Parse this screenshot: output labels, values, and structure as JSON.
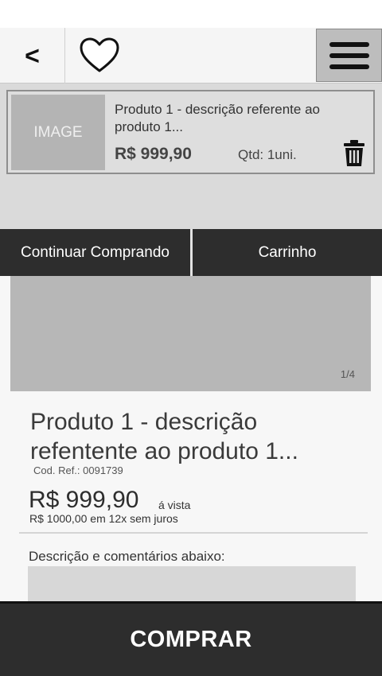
{
  "header": {
    "back_label": "<",
    "favorite_icon": "heart-icon",
    "menu_icon": "hamburger-menu-icon"
  },
  "cart": {
    "item": {
      "image_placeholder": "IMAGE",
      "title": "Produto 1 - descrição referente ao produto 1...",
      "price": "R$ 999,90",
      "quantity": "Qtd: 1uni.",
      "remove_icon": "trash-icon"
    }
  },
  "actions": {
    "continue_label": "Continuar Comprando",
    "cart_label": "Carrinho"
  },
  "carousel": {
    "indicator": "1/4",
    "current": 1,
    "total": 4
  },
  "product": {
    "title": "Produto 1 - descrição refentente ao produto 1...",
    "ref": "Cod. Ref.: 0091739",
    "price": "R$ 999,90",
    "price_note": "á vista",
    "installments": "R$ 1000,00 em 12x sem juros",
    "description_label": "Descrição e comentários abaixo:"
  },
  "footer": {
    "buy_label": "COMPRAR"
  },
  "colors": {
    "dark_bar": "#2d2d2d",
    "placeholder_gray": "#b7b7b7",
    "menu_button_bg": "#bdbdbd"
  }
}
